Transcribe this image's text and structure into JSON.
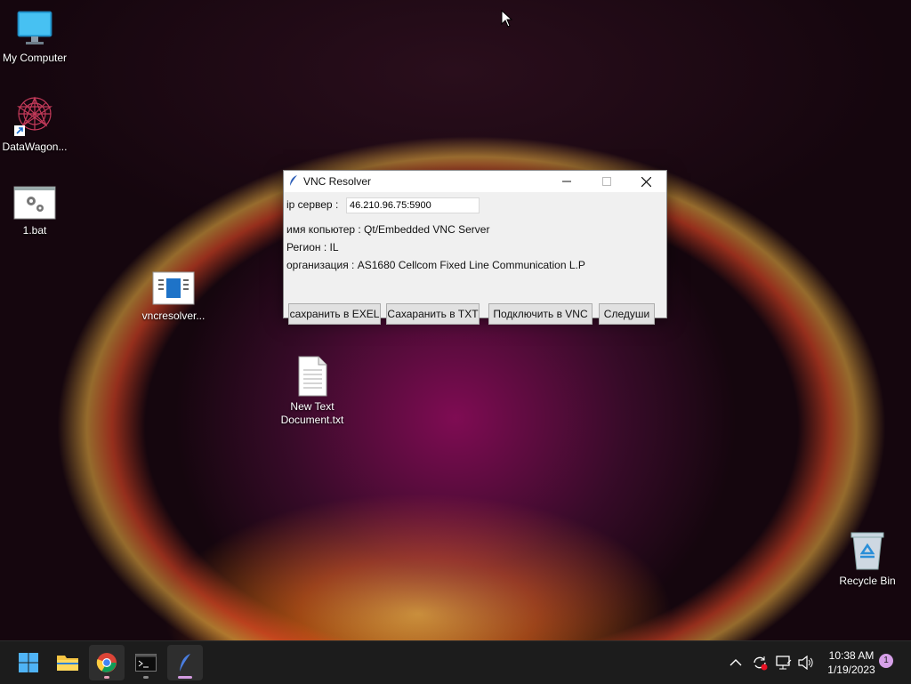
{
  "desktop": {
    "icons": [
      {
        "label": "My Computer"
      },
      {
        "label": "DataWagon..."
      },
      {
        "label": "1.bat"
      },
      {
        "label": "vncresolver..."
      },
      {
        "label": "New Text Document.txt"
      },
      {
        "label": "Recycle Bin"
      }
    ]
  },
  "window": {
    "title": "VNC Resolver",
    "ip_label": "ip сервер :",
    "ip_value": "46.210.96.75:5900",
    "computer_name": "имя копьютер : Qt/Embedded VNC Server",
    "region": "Регион : IL",
    "organization": "организация : AS1680 Cellcom Fixed Line Communication L.P",
    "buttons": {
      "save_excel": "сахранить в EXEL",
      "save_txt": "Сахаранить в TXT",
      "connect_vnc": "Подключить в VNC",
      "next": "Следуши"
    }
  },
  "taskbar": {
    "clock_time": "10:38 AM",
    "clock_date": "1/19/2023",
    "notification_count": "1"
  },
  "colors": {
    "accent": "#0067c0",
    "window_bg": "#f0f0f0",
    "taskbar_bg": "#1c1c1c"
  }
}
